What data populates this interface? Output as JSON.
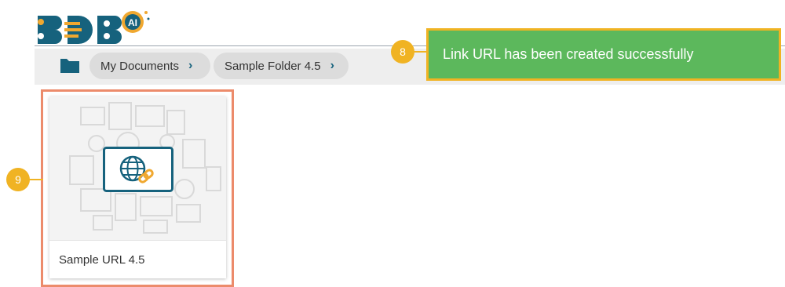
{
  "brand": {
    "logo_text": "BDB",
    "logo_badge": "AI"
  },
  "breadcrumb": {
    "items": [
      {
        "label": "My Documents"
      },
      {
        "label": "Sample Folder 4.5"
      }
    ],
    "chevron": "›"
  },
  "toast": {
    "message": "Link URL has been created successfully"
  },
  "callouts": {
    "toast_step": "8",
    "card_step": "9"
  },
  "card": {
    "title": "Sample URL 4.5",
    "type_icon": "globe-link-icon"
  },
  "colors": {
    "brand_teal": "#16627d",
    "brand_orange": "#f0a830",
    "toast_bg": "#5cb85c",
    "callout": "#f0b323",
    "highlight": "#ec8b6b"
  }
}
